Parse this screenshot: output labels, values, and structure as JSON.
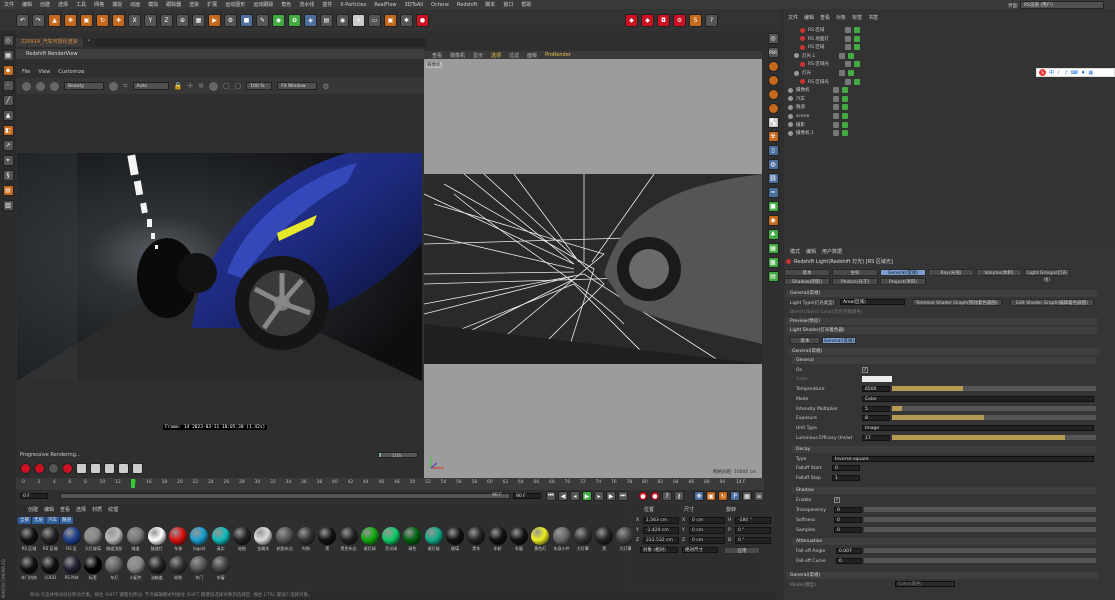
{
  "menubar": [
    "文件",
    "编辑",
    "创建",
    "选择",
    "工具",
    "网格",
    "捕捉",
    "动画",
    "模拟",
    "跟踪器",
    "渲染",
    "扩展",
    "运动图形",
    "运动跟踪",
    "角色",
    "流水线",
    "插件",
    "X-Particles",
    "RealFlow",
    "3DToAll",
    "Octane",
    "Redshift",
    "脚本",
    "窗口",
    "帮助"
  ],
  "layout_label": "界面:",
  "layout_value": "RS渲染 (用户)",
  "file_tabs": [
    "220914_汽车可视化渲染",
    "*"
  ],
  "render_view": {
    "title": "Redshift RenderView",
    "menu": [
      "File",
      "View",
      "Customize"
    ],
    "mode": "Beauty",
    "auto": "Auto",
    "zoom": "100 %",
    "fit": "Fit Window",
    "frame_label": "Frame: 14  2023-03-11 10:05:30 (1.42s)",
    "progress": "Progressive Rendering...",
    "progress_value": "1/16"
  },
  "viewport": {
    "menu": [
      "查看",
      "摄像机",
      "显示",
      "选项",
      "过滤",
      "面板",
      "ProRender"
    ],
    "camera": "摄像机",
    "grid": "网格间距: 10000 cm"
  },
  "timeline": {
    "ticks": [
      "0",
      "2",
      "4",
      "6",
      "8",
      "10",
      "12",
      "14",
      "16",
      "18",
      "20",
      "22",
      "24",
      "26",
      "28",
      "30",
      "32",
      "34",
      "36",
      "38",
      "40",
      "42",
      "44",
      "46",
      "48",
      "50",
      "52",
      "54",
      "56",
      "58",
      "60",
      "62",
      "64",
      "66",
      "68",
      "70",
      "72",
      "74",
      "76",
      "78",
      "80",
      "82",
      "84",
      "86",
      "88",
      "90"
    ],
    "current": "14",
    "end_label": "14 F",
    "start": "0 F",
    "end": "90 F",
    "max": "90 F"
  },
  "materials": {
    "menu": [
      "创建",
      "编辑",
      "查看",
      "选择",
      "材质",
      "纹理"
    ],
    "filters": [
      "全部",
      "无层",
      "汽车",
      "隧道"
    ],
    "row1": [
      {
        "label": "RS 区域",
        "color": "#111"
      },
      {
        "label": "RS 区域",
        "color": "#222"
      },
      {
        "label": "RS 区",
        "color": "#1e3f8a"
      },
      {
        "label": "大灯玻璃",
        "color": "#888"
      },
      {
        "label": "隧道顶部",
        "color": "#bbb"
      },
      {
        "label": "隧道",
        "color": "#777"
      },
      {
        "label": "隧道灯",
        "color": "#fff"
      },
      {
        "label": "车漆",
        "color": "#d11"
      },
      {
        "label": "logo外",
        "color": "#1aa0d0"
      },
      {
        "label": "真实",
        "color": "#1bb"
      },
      {
        "label": "轮胎",
        "color": "#222"
      },
      {
        "label": "金属灰",
        "color": "#ddd"
      },
      {
        "label": "轮胎灰边",
        "color": "#555"
      },
      {
        "label": "内饰",
        "color": "#333"
      },
      {
        "label": "黑",
        "color": "#111"
      },
      {
        "label": "黑色车边",
        "color": "#222"
      },
      {
        "label": "尾灯绿",
        "color": "#1a1"
      },
      {
        "label": "荧光绿",
        "color": "#1c6"
      },
      {
        "label": "绿色",
        "color": "#061"
      },
      {
        "label": "尾灯玻",
        "color": "#1a8"
      },
      {
        "label": "玻璃",
        "color": "#111"
      },
      {
        "label": "黑车",
        "color": "#222"
      },
      {
        "label": "车轮",
        "color": "#111"
      },
      {
        "label": "车窗",
        "color": "#111"
      },
      {
        "label": "黄色灯",
        "color": "#ee2"
      },
      {
        "label": "车身小件",
        "color": "#666"
      },
      {
        "label": "大灯罩",
        "color": "#333"
      },
      {
        "label": "黑",
        "color": "#222"
      },
      {
        "label": "大灯罩",
        "color": "#444"
      }
    ],
    "row2": [
      {
        "label": "车门内饰",
        "color": "#111"
      },
      {
        "label": "LOGO",
        "color": "#111"
      },
      {
        "label": "RS Mat",
        "color": "#223"
      },
      {
        "label": "标签",
        "color": "#000"
      },
      {
        "label": "车灯",
        "color": "#666"
      },
      {
        "label": "小配件",
        "color": "#888"
      },
      {
        "label": "油箱盖",
        "color": "#222"
      },
      {
        "label": "轮胎",
        "color": "#333"
      },
      {
        "label": "车门",
        "color": "#555"
      },
      {
        "label": "车窗",
        "color": "#444"
      }
    ]
  },
  "coords": {
    "headers": [
      "位置",
      "尺寸",
      "旋转"
    ],
    "rows": [
      [
        "X",
        "1.563 cm",
        "X",
        "0 cm",
        "H",
        "-180 °"
      ],
      [
        "Y",
        "-1.429 cm",
        "Y",
        "0 cm",
        "P",
        "0 °"
      ],
      [
        "Z",
        "222.532 cm",
        "Z",
        "0 cm",
        "B",
        "0 °"
      ]
    ],
    "mode1": "对象 (相对)",
    "mode2": "绝对尺寸",
    "apply": "应用"
  },
  "objects": {
    "menu": [
      "文件",
      "编辑",
      "查看",
      "对象",
      "标签",
      "书签"
    ],
    "rows": [
      {
        "name": "RS 区域",
        "indent": 2
      },
      {
        "name": "RS 地面灯",
        "indent": 2
      },
      {
        "name": "RS 区域",
        "indent": 2
      },
      {
        "name": "灯光.1",
        "indent": 1
      },
      {
        "name": "RS 区域光",
        "indent": 2
      },
      {
        "name": "灯光",
        "indent": 1
      },
      {
        "name": "RS 区域光",
        "indent": 2
      },
      {
        "name": "摄像机",
        "indent": 0
      },
      {
        "name": "汽车",
        "indent": 0
      },
      {
        "name": "隧道",
        "indent": 0
      },
      {
        "name": "scene",
        "indent": 0
      },
      {
        "name": "摄影",
        "indent": 0
      },
      {
        "name": "摄像机.1",
        "indent": 0
      }
    ]
  },
  "attributes": {
    "menu": [
      "模式",
      "编辑",
      "用户数据"
    ],
    "title": "Redshift Light(Redshift 灯光) [RS 区域光]",
    "tabs_row1": [
      "基本",
      "坐标",
      "General(常规)",
      "Ray(光线)",
      "Volume(体积)",
      "Light Groups(灯光组)"
    ],
    "tabs_row2": [
      "Shadow(阴影)",
      "Photon(光子)",
      "Project(项目)"
    ],
    "general_header": "General(常规)",
    "light_type_label": "Light Type(灯光类型)",
    "light_type": "Area(区域)",
    "remove_shader": "Remove Shader Graph(移除着色器图)",
    "edit_shader": "Edit Shader Graph(编辑着色器图)",
    "blend_label": "Blend Object Color(混合对象颜色)",
    "preview": "Preview(预览)",
    "light_shader": "Light Shader(灯光着色器)",
    "sub_tabs": [
      "基本",
      "General(常规)"
    ],
    "general2": "General(常规)",
    "general3": "General",
    "on_label": "On",
    "color_label": "Color",
    "params": [
      {
        "label": "Temperature",
        "value": "6500",
        "fill": 0.35
      },
      {
        "label": "Mode",
        "value": "Color"
      },
      {
        "label": "Intensity Multiplier",
        "value": "5",
        "fill": 0.05
      },
      {
        "label": "Exposure",
        "value": "8",
        "fill": 0.45
      },
      {
        "label": "Unit Type",
        "value": "Image"
      },
      {
        "label": "Luminous Efficacy (lm/w)",
        "value": "17",
        "fill": 0.85
      }
    ],
    "decay": "Decay",
    "decay_type_label": "Type",
    "decay_type": "Inverse-square",
    "falloff_start_label": "Falloff Start",
    "falloff_start": "0",
    "falloff_stop_label": "Falloff Stop",
    "falloff_stop": "1",
    "shadow": "Shadow",
    "enable_label": "Enable",
    "shadow_params": [
      {
        "label": "Transparency",
        "value": "0"
      },
      {
        "label": "Softness",
        "value": "0"
      },
      {
        "label": "Samples",
        "value": "0"
      }
    ],
    "attenuation": "Attenuation",
    "falloff_angle_label": "Fall-off Angle",
    "falloff_angle": "0.007",
    "falloff_curve_label": "Fall-off Curve",
    "falloff_curve": "0",
    "general_bottom": "General(常规)",
    "model_label": "Model(模型)",
    "model_value": "Color(颜色)"
  },
  "status": "移动:点击并拖动鼠标移动元素。按住 SHIFT 键量化移动; 节点编辑模式时按住 SHIFT 键增加选择对象到选择区; 按住 CTRL 键减少选择对象。",
  "ime": {
    "s": "S",
    "text": "中"
  }
}
